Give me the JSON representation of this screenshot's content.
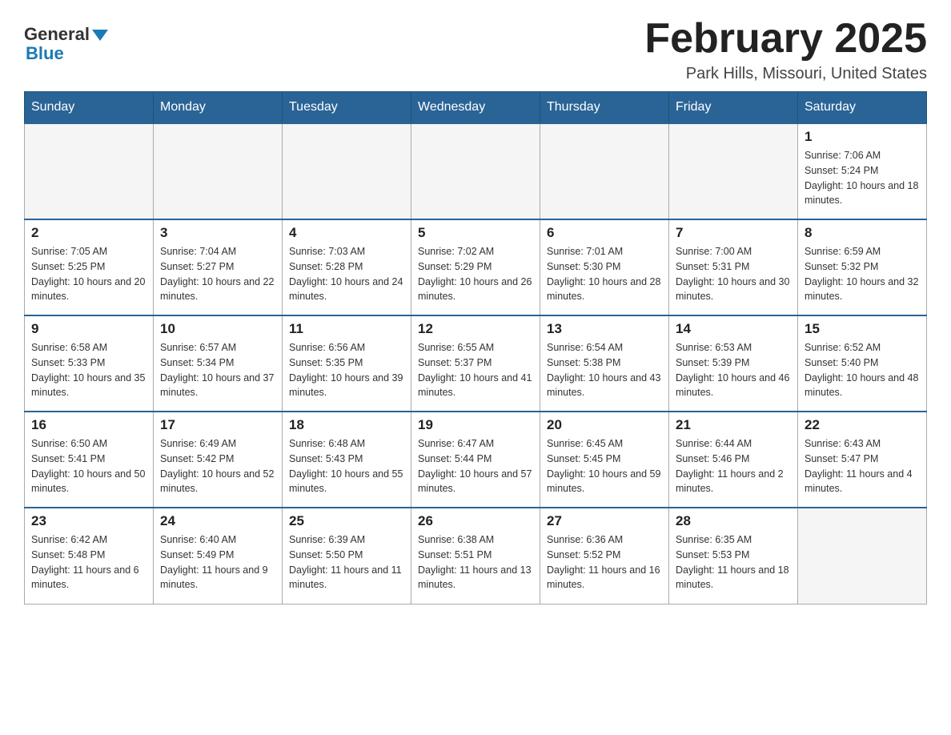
{
  "logo": {
    "general": "General",
    "blue": "Blue"
  },
  "title": "February 2025",
  "subtitle": "Park Hills, Missouri, United States",
  "days_of_week": [
    "Sunday",
    "Monday",
    "Tuesday",
    "Wednesday",
    "Thursday",
    "Friday",
    "Saturday"
  ],
  "weeks": [
    [
      {
        "day": "",
        "info": ""
      },
      {
        "day": "",
        "info": ""
      },
      {
        "day": "",
        "info": ""
      },
      {
        "day": "",
        "info": ""
      },
      {
        "day": "",
        "info": ""
      },
      {
        "day": "",
        "info": ""
      },
      {
        "day": "1",
        "info": "Sunrise: 7:06 AM\nSunset: 5:24 PM\nDaylight: 10 hours and 18 minutes."
      }
    ],
    [
      {
        "day": "2",
        "info": "Sunrise: 7:05 AM\nSunset: 5:25 PM\nDaylight: 10 hours and 20 minutes."
      },
      {
        "day": "3",
        "info": "Sunrise: 7:04 AM\nSunset: 5:27 PM\nDaylight: 10 hours and 22 minutes."
      },
      {
        "day": "4",
        "info": "Sunrise: 7:03 AM\nSunset: 5:28 PM\nDaylight: 10 hours and 24 minutes."
      },
      {
        "day": "5",
        "info": "Sunrise: 7:02 AM\nSunset: 5:29 PM\nDaylight: 10 hours and 26 minutes."
      },
      {
        "day": "6",
        "info": "Sunrise: 7:01 AM\nSunset: 5:30 PM\nDaylight: 10 hours and 28 minutes."
      },
      {
        "day": "7",
        "info": "Sunrise: 7:00 AM\nSunset: 5:31 PM\nDaylight: 10 hours and 30 minutes."
      },
      {
        "day": "8",
        "info": "Sunrise: 6:59 AM\nSunset: 5:32 PM\nDaylight: 10 hours and 32 minutes."
      }
    ],
    [
      {
        "day": "9",
        "info": "Sunrise: 6:58 AM\nSunset: 5:33 PM\nDaylight: 10 hours and 35 minutes."
      },
      {
        "day": "10",
        "info": "Sunrise: 6:57 AM\nSunset: 5:34 PM\nDaylight: 10 hours and 37 minutes."
      },
      {
        "day": "11",
        "info": "Sunrise: 6:56 AM\nSunset: 5:35 PM\nDaylight: 10 hours and 39 minutes."
      },
      {
        "day": "12",
        "info": "Sunrise: 6:55 AM\nSunset: 5:37 PM\nDaylight: 10 hours and 41 minutes."
      },
      {
        "day": "13",
        "info": "Sunrise: 6:54 AM\nSunset: 5:38 PM\nDaylight: 10 hours and 43 minutes."
      },
      {
        "day": "14",
        "info": "Sunrise: 6:53 AM\nSunset: 5:39 PM\nDaylight: 10 hours and 46 minutes."
      },
      {
        "day": "15",
        "info": "Sunrise: 6:52 AM\nSunset: 5:40 PM\nDaylight: 10 hours and 48 minutes."
      }
    ],
    [
      {
        "day": "16",
        "info": "Sunrise: 6:50 AM\nSunset: 5:41 PM\nDaylight: 10 hours and 50 minutes."
      },
      {
        "day": "17",
        "info": "Sunrise: 6:49 AM\nSunset: 5:42 PM\nDaylight: 10 hours and 52 minutes."
      },
      {
        "day": "18",
        "info": "Sunrise: 6:48 AM\nSunset: 5:43 PM\nDaylight: 10 hours and 55 minutes."
      },
      {
        "day": "19",
        "info": "Sunrise: 6:47 AM\nSunset: 5:44 PM\nDaylight: 10 hours and 57 minutes."
      },
      {
        "day": "20",
        "info": "Sunrise: 6:45 AM\nSunset: 5:45 PM\nDaylight: 10 hours and 59 minutes."
      },
      {
        "day": "21",
        "info": "Sunrise: 6:44 AM\nSunset: 5:46 PM\nDaylight: 11 hours and 2 minutes."
      },
      {
        "day": "22",
        "info": "Sunrise: 6:43 AM\nSunset: 5:47 PM\nDaylight: 11 hours and 4 minutes."
      }
    ],
    [
      {
        "day": "23",
        "info": "Sunrise: 6:42 AM\nSunset: 5:48 PM\nDaylight: 11 hours and 6 minutes."
      },
      {
        "day": "24",
        "info": "Sunrise: 6:40 AM\nSunset: 5:49 PM\nDaylight: 11 hours and 9 minutes."
      },
      {
        "day": "25",
        "info": "Sunrise: 6:39 AM\nSunset: 5:50 PM\nDaylight: 11 hours and 11 minutes."
      },
      {
        "day": "26",
        "info": "Sunrise: 6:38 AM\nSunset: 5:51 PM\nDaylight: 11 hours and 13 minutes."
      },
      {
        "day": "27",
        "info": "Sunrise: 6:36 AM\nSunset: 5:52 PM\nDaylight: 11 hours and 16 minutes."
      },
      {
        "day": "28",
        "info": "Sunrise: 6:35 AM\nSunset: 5:53 PM\nDaylight: 11 hours and 18 minutes."
      },
      {
        "day": "",
        "info": ""
      }
    ]
  ]
}
